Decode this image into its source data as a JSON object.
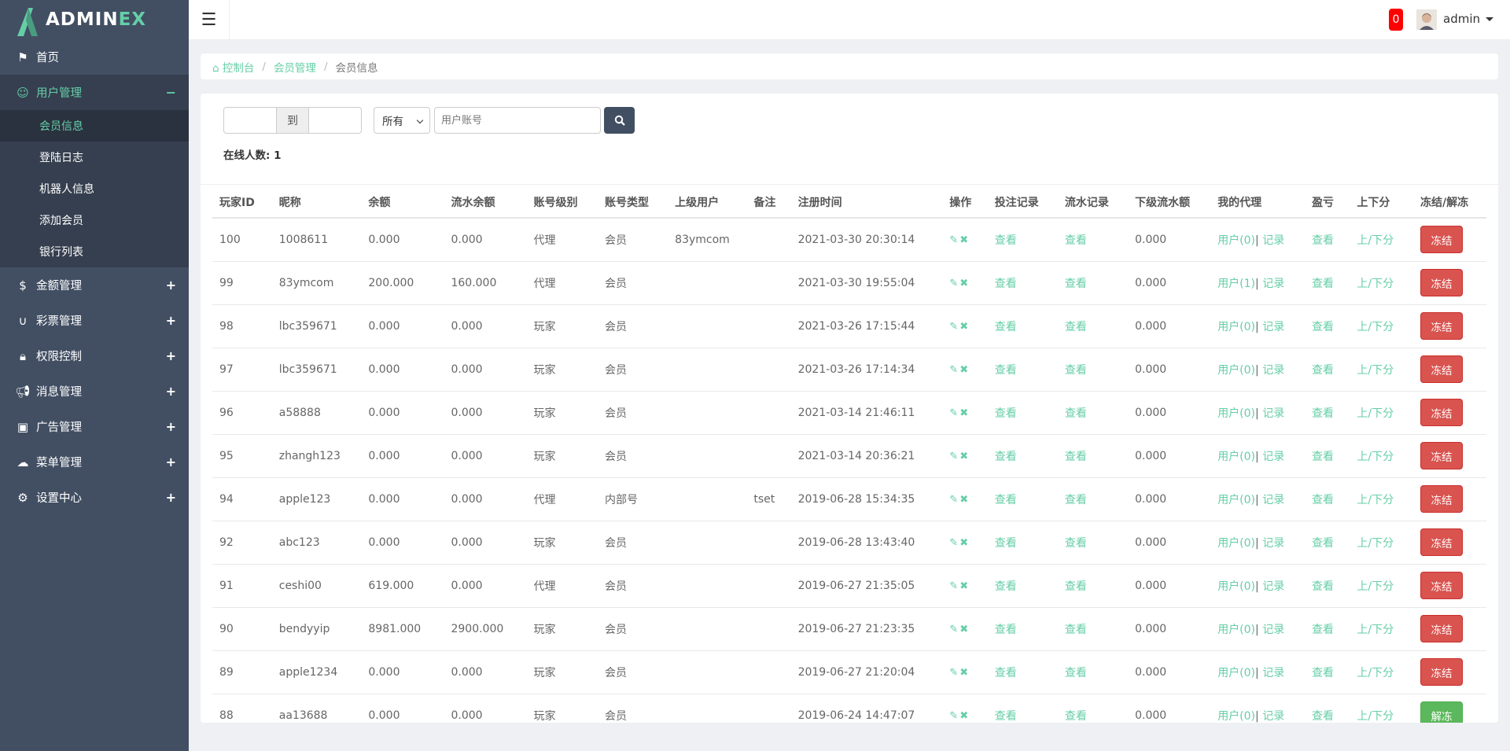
{
  "brand": {
    "prefix": "ADMIN",
    "suffix": "EX"
  },
  "sidebar": {
    "items": [
      {
        "label": "首页",
        "icon": "flag-icon",
        "sign": ""
      },
      {
        "label": "用户管理",
        "icon": "user-circle-icon",
        "sign": "−",
        "active": true,
        "sub": [
          "会员信息",
          "登陆日志",
          "机器人信息",
          "添加会员",
          "银行列表"
        ]
      },
      {
        "label": "金额管理",
        "icon": "dollar-icon",
        "sign": "+"
      },
      {
        "label": "彩票管理",
        "icon": "magnet-icon",
        "sign": "+"
      },
      {
        "label": "权限控制",
        "icon": "lock-icon",
        "sign": "+"
      },
      {
        "label": "消息管理",
        "icon": "bullhorn-icon",
        "sign": "+"
      },
      {
        "label": "广告管理",
        "icon": "image-icon",
        "sign": "+"
      },
      {
        "label": "菜单管理",
        "icon": "cloud-icon",
        "sign": "+"
      },
      {
        "label": "设置中心",
        "icon": "gear-icon",
        "sign": "+"
      }
    ]
  },
  "header": {
    "notifications": "0",
    "user": "admin"
  },
  "breadcrumb": {
    "home": "控制台",
    "section": "会员管理",
    "current": "会员信息"
  },
  "filters": {
    "to_label": "到",
    "select_value": "所有",
    "search_placeholder": "用户账号"
  },
  "online": {
    "label": "在线人数:",
    "count": "1"
  },
  "table": {
    "headers": [
      "玩家ID",
      "昵称",
      "余额",
      "流水余额",
      "账号级别",
      "账号类型",
      "上级用户",
      "备注",
      "注册时间",
      "操作",
      "投注记录",
      "流水记录",
      "下级流水额",
      "我的代理",
      "盈亏",
      "上下分",
      "冻结/解冻"
    ],
    "link_view": "查看",
    "link_record": "记录",
    "link_updown": "上/下分",
    "rows": [
      {
        "id": "100",
        "nick": "1008611",
        "bal": "0.000",
        "flow": "0.000",
        "level": "代理",
        "type": "会员",
        "parent": "83ymcom",
        "note": "",
        "time": "2021-03-30 20:30:14",
        "sub": "0.000",
        "agent": "用户(0)",
        "freeze": "冻结"
      },
      {
        "id": "99",
        "nick": "83ymcom",
        "bal": "200.000",
        "flow": "160.000",
        "level": "代理",
        "type": "会员",
        "parent": "",
        "note": "",
        "time": "2021-03-30 19:55:04",
        "sub": "0.000",
        "agent": "用户(1)",
        "freeze": "冻结"
      },
      {
        "id": "98",
        "nick": "lbc359671",
        "bal": "0.000",
        "flow": "0.000",
        "level": "玩家",
        "type": "会员",
        "parent": "",
        "note": "",
        "time": "2021-03-26 17:15:44",
        "sub": "0.000",
        "agent": "用户(0)",
        "freeze": "冻结"
      },
      {
        "id": "97",
        "nick": "lbc359671",
        "bal": "0.000",
        "flow": "0.000",
        "level": "玩家",
        "type": "会员",
        "parent": "",
        "note": "",
        "time": "2021-03-26 17:14:34",
        "sub": "0.000",
        "agent": "用户(0)",
        "freeze": "冻结"
      },
      {
        "id": "96",
        "nick": "a58888",
        "bal": "0.000",
        "flow": "0.000",
        "level": "玩家",
        "type": "会员",
        "parent": "",
        "note": "",
        "time": "2021-03-14 21:46:11",
        "sub": "0.000",
        "agent": "用户(0)",
        "freeze": "冻结"
      },
      {
        "id": "95",
        "nick": "zhangh123",
        "bal": "0.000",
        "flow": "0.000",
        "level": "玩家",
        "type": "会员",
        "parent": "",
        "note": "",
        "time": "2021-03-14 20:36:21",
        "sub": "0.000",
        "agent": "用户(0)",
        "freeze": "冻结"
      },
      {
        "id": "94",
        "nick": "apple123",
        "bal": "0.000",
        "flow": "0.000",
        "level": "代理",
        "type": "内部号",
        "parent": "",
        "note": "tset",
        "time": "2019-06-28 15:34:35",
        "sub": "0.000",
        "agent": "用户(0)",
        "freeze": "冻结"
      },
      {
        "id": "92",
        "nick": "abc123",
        "bal": "0.000",
        "flow": "0.000",
        "level": "玩家",
        "type": "会员",
        "parent": "",
        "note": "",
        "time": "2019-06-28 13:43:40",
        "sub": "0.000",
        "agent": "用户(0)",
        "freeze": "冻结"
      },
      {
        "id": "91",
        "nick": "ceshi00",
        "bal": "619.000",
        "flow": "0.000",
        "level": "代理",
        "type": "会员",
        "parent": "",
        "note": "",
        "time": "2019-06-27 21:35:05",
        "sub": "0.000",
        "agent": "用户(0)",
        "freeze": "冻结"
      },
      {
        "id": "90",
        "nick": "bendyyip",
        "bal": "8981.000",
        "flow": "2900.000",
        "level": "玩家",
        "type": "会员",
        "parent": "",
        "note": "",
        "time": "2019-06-27 21:23:35",
        "sub": "0.000",
        "agent": "用户(0)",
        "freeze": "冻结"
      },
      {
        "id": "89",
        "nick": "apple1234",
        "bal": "0.000",
        "flow": "0.000",
        "level": "玩家",
        "type": "会员",
        "parent": "",
        "note": "",
        "time": "2019-06-27 21:20:04",
        "sub": "0.000",
        "agent": "用户(0)",
        "freeze": "冻结"
      },
      {
        "id": "88",
        "nick": "aa13688",
        "bal": "0.000",
        "flow": "0.000",
        "level": "玩家",
        "type": "会员",
        "parent": "",
        "note": "",
        "time": "2019-06-24 14:47:07",
        "sub": "0.000",
        "agent": "用户(0)",
        "freeze": "解冻"
      }
    ]
  }
}
